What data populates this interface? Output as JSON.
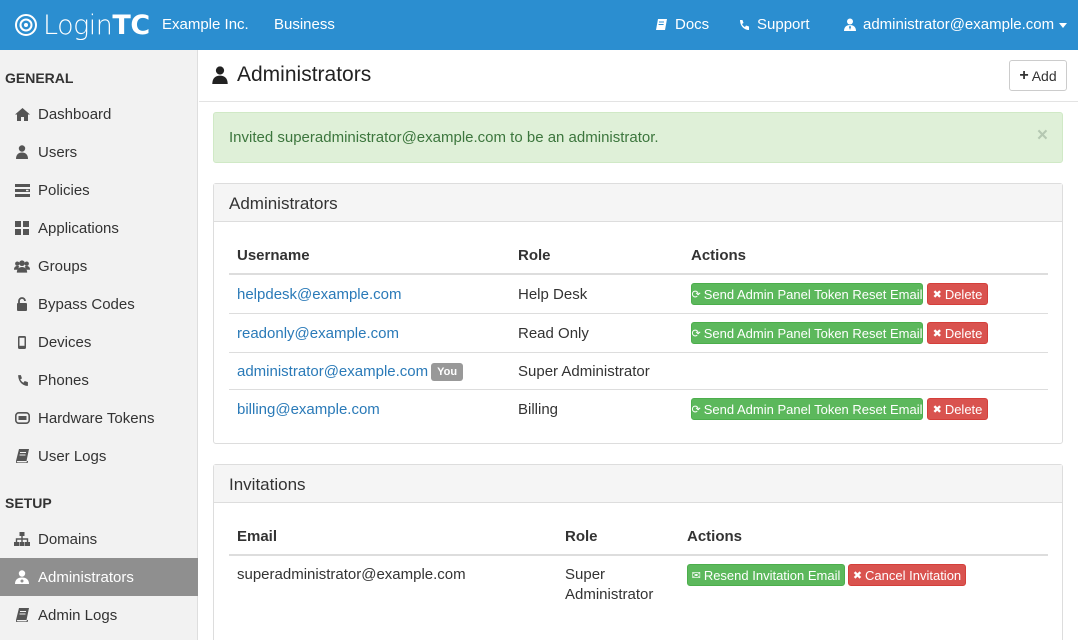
{
  "navbar": {
    "brand_light": "Login",
    "brand_bold": "TC",
    "org": "Example Inc.",
    "plan": "Business",
    "docs": "Docs",
    "support": "Support",
    "user": "administrator@example.com"
  },
  "sidebar": {
    "general_heading": "GENERAL",
    "setup_heading": "SETUP",
    "general_items": [
      {
        "label": "Dashboard",
        "icon": "home-icon"
      },
      {
        "label": "Users",
        "icon": "user-icon"
      },
      {
        "label": "Policies",
        "icon": "policy-icon"
      },
      {
        "label": "Applications",
        "icon": "grid-icon"
      },
      {
        "label": "Groups",
        "icon": "group-icon"
      },
      {
        "label": "Bypass Codes",
        "icon": "unlock-icon"
      },
      {
        "label": "Devices",
        "icon": "mobile-icon"
      },
      {
        "label": "Phones",
        "icon": "phone-icon"
      },
      {
        "label": "Hardware Tokens",
        "icon": "token-icon"
      },
      {
        "label": "User Logs",
        "icon": "book-icon"
      }
    ],
    "setup_items": [
      {
        "label": "Domains",
        "icon": "sitemap-icon"
      },
      {
        "label": "Administrators",
        "icon": "admin-icon",
        "active": true
      },
      {
        "label": "Admin Logs",
        "icon": "book-icon"
      }
    ]
  },
  "page": {
    "title": "Administrators",
    "add_label": "Add"
  },
  "alert": {
    "message": "Invited superadministrator@example.com to be an administrator.",
    "close": "×"
  },
  "admins_panel": {
    "title": "Administrators",
    "columns": [
      "Username",
      "Role",
      "Actions"
    ],
    "rows": [
      {
        "username": "helpdesk@example.com",
        "role": "Help Desk"
      },
      {
        "username": "readonly@example.com",
        "role": "Read Only"
      },
      {
        "username": "administrator@example.com",
        "role": "Super Administrator",
        "badge": "You"
      },
      {
        "username": "billing@example.com",
        "role": "Billing"
      }
    ],
    "reset_label": "Send Admin Panel Token Reset Email",
    "delete_label": "Delete"
  },
  "invites_panel": {
    "title": "Invitations",
    "columns": [
      "Email",
      "Role",
      "Actions"
    ],
    "rows": [
      {
        "email": "superadministrator@example.com",
        "role_line1": "Super",
        "role_line2": "Administrator"
      }
    ],
    "resend_label": "Resend Invitation Email",
    "cancel_label": "Cancel Invitation"
  },
  "colors": {
    "navbar": "#2b8ed0",
    "link": "#2a7ab8",
    "success": "#5cb85c",
    "danger": "#d9534f",
    "sidebar_active": "#8f8f8f"
  }
}
